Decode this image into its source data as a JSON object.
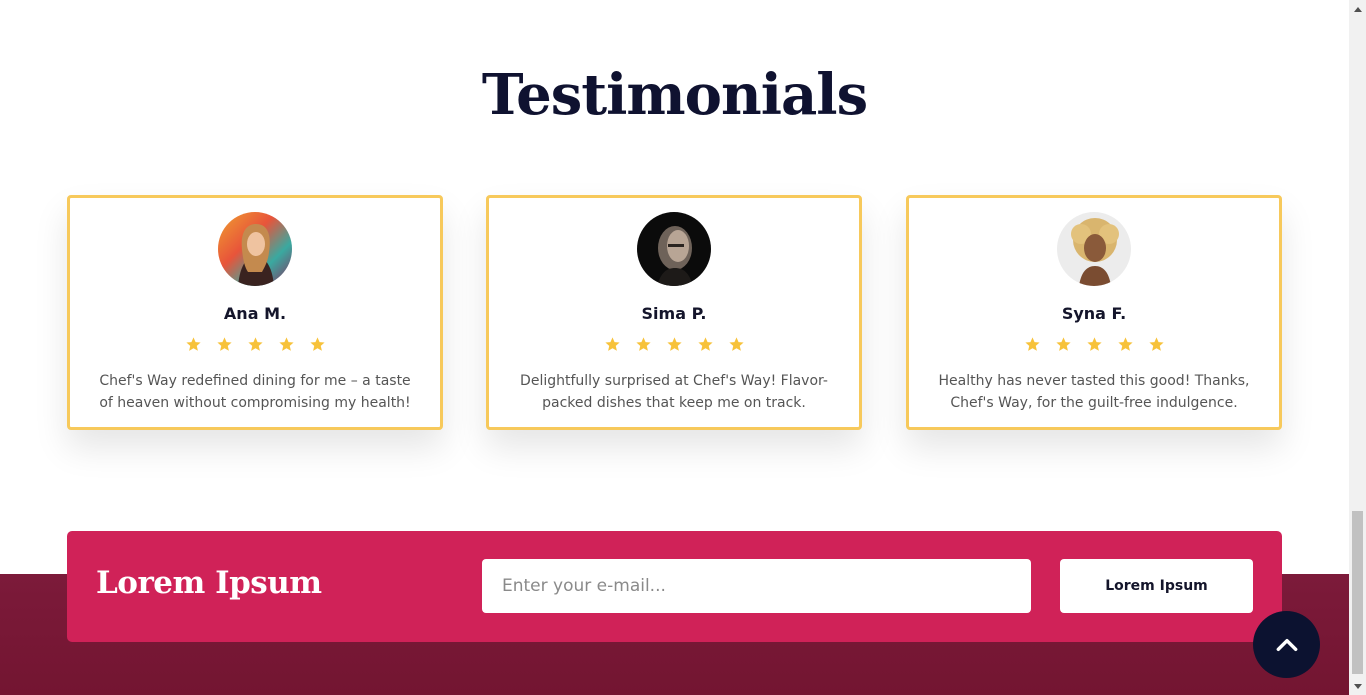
{
  "testimonials": {
    "title": "Testimonials",
    "cards": [
      {
        "name": "Ana M.",
        "rating": 5,
        "quote": "Chef's Way redefined dining for me – a taste of heaven without compromising my health!"
      },
      {
        "name": "Sima P.",
        "rating": 5,
        "quote": "Delightfully surprised at Chef's Way! Flavor-packed dishes that keep me on track."
      },
      {
        "name": "Syna F.",
        "rating": 5,
        "quote": "Healthy has never tasted this good! Thanks, Chef's Way, for the guilt-free indulgence."
      }
    ]
  },
  "newsletter": {
    "title": "Lorem Ipsum",
    "email_placeholder": "Enter your e-mail...",
    "button_label": "Lorem Ipsum"
  },
  "colors": {
    "card_border": "#f7c95b",
    "star": "#f7c23a",
    "newsletter_bg": "#d02258",
    "footer_bg": "#7c1a3a",
    "scroll_top_bg": "#0c1230"
  },
  "icons": {
    "star": "star-icon",
    "scroll_top": "chevron-up-icon"
  }
}
